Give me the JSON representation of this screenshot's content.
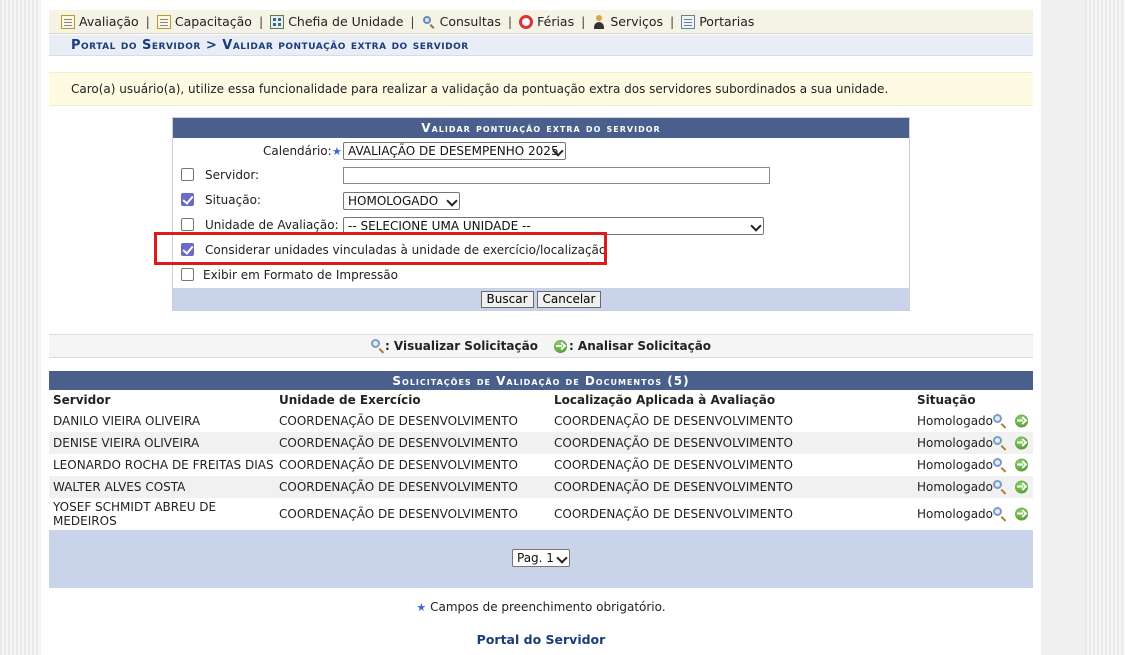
{
  "menu": {
    "items": [
      {
        "label": "Avaliação",
        "icon": "document-icon"
      },
      {
        "label": "Capacitação",
        "icon": "document-icon"
      },
      {
        "label": "Chefia de Unidade",
        "icon": "grid-icon"
      },
      {
        "label": "Consultas",
        "icon": "magnifier-icon"
      },
      {
        "label": "Férias",
        "icon": "lifebuoy-icon"
      },
      {
        "label": "Serviços",
        "icon": "person-icon"
      },
      {
        "label": "Portarias",
        "icon": "sheet-icon"
      }
    ],
    "separator": "|"
  },
  "breadcrumb": "Portal do Servidor > Validar pontuação extra do servidor",
  "info": "Caro(a) usuário(a), utilize essa funcionalidade para realizar a validação da pontuação extra dos servidores subordinados a sua unidade.",
  "form": {
    "title": "Validar pontuação extra do servidor",
    "calendario_label": "Calendário:",
    "calendario_value": "AVALIAÇÃO DE DESEMPENHO 2025",
    "servidor_label": "Servidor:",
    "servidor_value": "",
    "servidor_checked": false,
    "situacao_label": "Situação:",
    "situacao_value": "HOMOLOGADO",
    "situacao_checked": true,
    "unidade_label": "Unidade de Avaliação:",
    "unidade_value": "-- SELECIONE UMA UNIDADE --",
    "unidade_checked": false,
    "considerar_label": "Considerar unidades vinculadas à unidade de exercício/localização",
    "considerar_checked": true,
    "impressao_label": "Exibir em Formato de Impressão",
    "impressao_checked": false,
    "buscar_label": "Buscar",
    "cancelar_label": "Cancelar",
    "required_star": "★"
  },
  "legend": {
    "visualizar": ": Visualizar Solicitação",
    "analisar": ": Analisar Solicitação"
  },
  "listing": {
    "title": "Solicitações de Validação de Documentos (5)",
    "columns": [
      "Servidor",
      "Unidade de Exercício",
      "Localização Aplicada à Avaliação",
      "Situação"
    ],
    "rows": [
      {
        "servidor": "DANILO VIEIRA OLIVEIRA",
        "unidade": "COORDENAÇÃO DE DESENVOLVIMENTO",
        "localizacao": "COORDENAÇÃO DE DESENVOLVIMENTO",
        "situacao": "Homologado"
      },
      {
        "servidor": "DENISE VIEIRA OLIVEIRA",
        "unidade": "COORDENAÇÃO DE DESENVOLVIMENTO",
        "localizacao": "COORDENAÇÃO DE DESENVOLVIMENTO",
        "situacao": "Homologado"
      },
      {
        "servidor": "LEONARDO ROCHA DE FREITAS DIAS",
        "unidade": "COORDENAÇÃO DE DESENVOLVIMENTO",
        "localizacao": "COORDENAÇÃO DE DESENVOLVIMENTO",
        "situacao": "Homologado"
      },
      {
        "servidor": "WALTER ALVES COSTA",
        "unidade": "COORDENAÇÃO DE DESENVOLVIMENTO",
        "localizacao": "COORDENAÇÃO DE DESENVOLVIMENTO",
        "situacao": "Homologado"
      },
      {
        "servidor": "YOSEF SCHMIDT ABREU DE MEDEIROS",
        "unidade": "COORDENAÇÃO DE DESENVOLVIMENTO",
        "localizacao": "COORDENAÇÃO DE DESENVOLVIMENTO",
        "situacao": "Homologado"
      }
    ],
    "page_select": "Pag. 1"
  },
  "footnote": "Campos de preenchimento obrigatório.",
  "portal_link": "Portal do Servidor",
  "colors": {
    "caption_bg": "#4a5f8c",
    "highlight_border": "#dd1b1b",
    "breadcrumb_text": "#1b3c7a",
    "checkbox_checked": "#6a6ac8"
  }
}
